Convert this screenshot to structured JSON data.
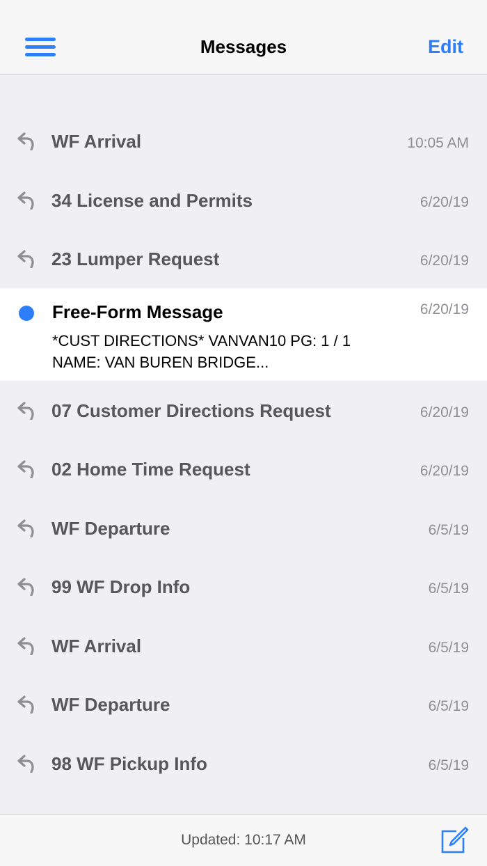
{
  "navbar": {
    "title": "Messages",
    "edit_label": "Edit",
    "menu_icon": "hamburger-menu-icon",
    "accent_color": "#2d7ff9"
  },
  "messages": [
    {
      "subject": "WF Arrival",
      "date": "10:05 AM",
      "status": "replied",
      "icon": "reply-arrow-icon"
    },
    {
      "subject": "34 License and Permits",
      "date": "6/20/19",
      "status": "replied",
      "icon": "reply-arrow-icon"
    },
    {
      "subject": "23 Lumper Request",
      "date": "6/20/19",
      "status": "replied",
      "icon": "reply-arrow-icon"
    },
    {
      "subject": "Free-Form Message",
      "date": "6/20/19",
      "status": "unread",
      "icon": "unread-dot",
      "preview_line1": "*CUST DIRECTIONS* VANVAN10 PG: 1  / 1",
      "preview_line2": "NAME: VAN BUREN BRIDGE..."
    },
    {
      "subject": "07 Customer Directions Request",
      "date": "6/20/19",
      "status": "replied",
      "icon": "reply-arrow-icon"
    },
    {
      "subject": "02 Home Time Request",
      "date": "6/20/19",
      "status": "replied",
      "icon": "reply-arrow-icon"
    },
    {
      "subject": "WF Departure",
      "date": "6/5/19",
      "status": "replied",
      "icon": "reply-arrow-icon"
    },
    {
      "subject": "99 WF Drop Info",
      "date": "6/5/19",
      "status": "replied",
      "icon": "reply-arrow-icon"
    },
    {
      "subject": "WF Arrival",
      "date": "6/5/19",
      "status": "replied",
      "icon": "reply-arrow-icon"
    },
    {
      "subject": "WF Departure",
      "date": "6/5/19",
      "status": "replied",
      "icon": "reply-arrow-icon"
    },
    {
      "subject": "98 WF Pickup Info",
      "date": "6/5/19",
      "status": "replied",
      "icon": "reply-arrow-icon"
    }
  ],
  "toolbar": {
    "updated_text": "Updated: 10:17 AM",
    "compose_icon": "compose-icon"
  }
}
